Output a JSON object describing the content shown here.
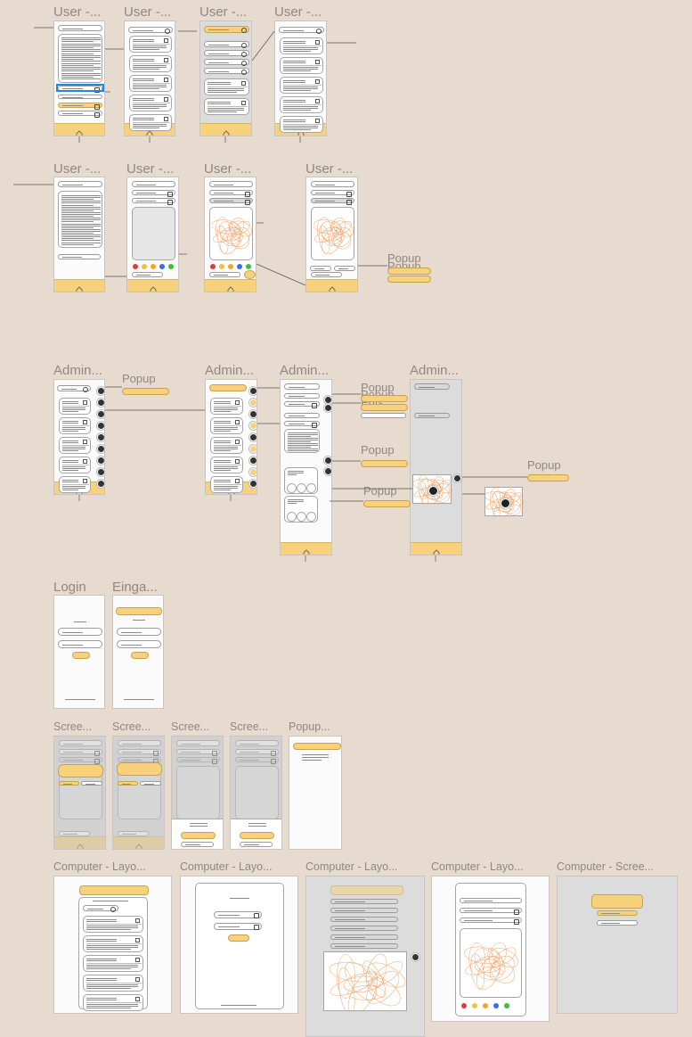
{
  "canvas": {
    "background": "#e7dbcf",
    "accent": "#f7d17b"
  },
  "rows": {
    "row1": [
      "User -...",
      "User -...",
      "User -...",
      "User -..."
    ],
    "row2": [
      "User -...",
      "User -...",
      "User -...",
      "User -..."
    ],
    "row3": [
      "Admin...",
      "Admin...",
      "Admin...",
      "Admin..."
    ],
    "row4": [
      "Login",
      "Einga..."
    ],
    "row5": [
      "Scree...",
      "Scree...",
      "Scree...",
      "Scree...",
      "Popup..."
    ],
    "row6": [
      "Computer - Layo...",
      "Computer - Layo...",
      "Computer - Layo...",
      "Computer - Layo...",
      "Computer - Scree..."
    ]
  },
  "popups": [
    "Popup",
    "Popup",
    "Popup",
    "Popup",
    "Popup",
    "Popup",
    "Popup",
    "Ents"
  ],
  "icons": {
    "home": "home-icon",
    "back": "undo-arrow-icon",
    "play": "play-icon",
    "pause": "pause-icon",
    "user": "user-icon",
    "lock": "lock-icon",
    "close": "close-icon"
  }
}
